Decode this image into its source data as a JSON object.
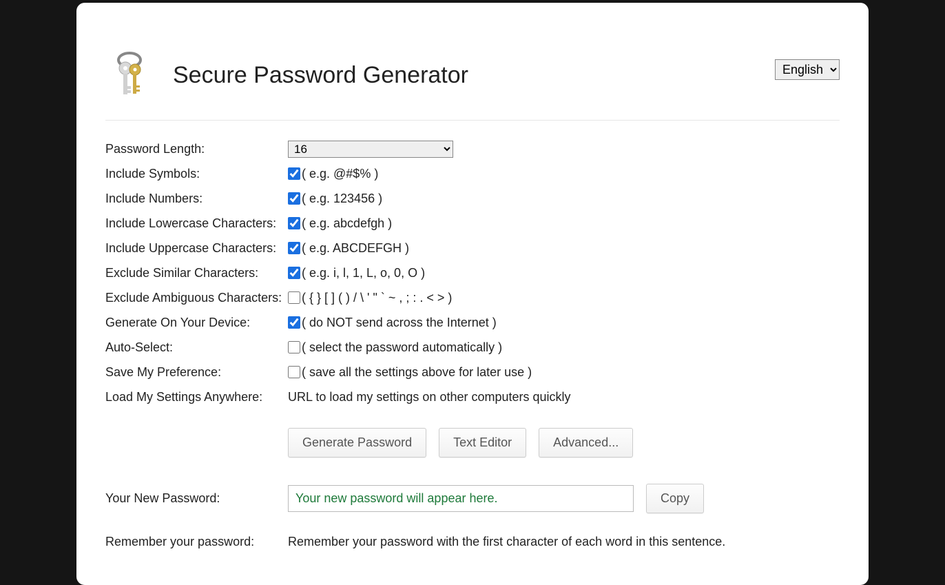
{
  "header": {
    "title": "Secure Password Generator",
    "language_selected": "English"
  },
  "labels": {
    "password_length": "Password Length:",
    "include_symbols": "Include Symbols:",
    "include_numbers": "Include Numbers:",
    "include_lowercase": "Include Lowercase Characters:",
    "include_uppercase": "Include Uppercase Characters:",
    "exclude_similar": "Exclude Similar Characters:",
    "exclude_ambiguous": "Exclude Ambiguous Characters:",
    "generate_on_device": "Generate On Your Device:",
    "auto_select": "Auto-Select:",
    "save_preference": "Save My Preference:",
    "load_settings": "Load My Settings Anywhere:",
    "your_new_password": "Your New Password:",
    "remember": "Remember your password:"
  },
  "hints": {
    "symbols": "( e.g. @#$% )",
    "numbers": "( e.g. 123456 )",
    "lowercase": "( e.g. abcdefgh )",
    "uppercase": "( e.g. ABCDEFGH )",
    "similar": "( e.g. i, l, 1, L, o, 0, O )",
    "ambiguous": "( { } [ ] ( ) / \\ ' \" ` ~ , ; : . < > )",
    "on_device": "( do NOT send across the Internet )",
    "auto_select": "( select the password automatically )",
    "save_pref": "( save all the settings above for later use )",
    "load_settings": "URL to load my settings on other computers quickly",
    "remember": "Remember your password with the first character of each word in this sentence."
  },
  "values": {
    "password_length": "16",
    "new_password_placeholder": "Your new password will appear here."
  },
  "buttons": {
    "generate": "Generate Password",
    "text_editor": "Text Editor",
    "advanced": "Advanced...",
    "copy": "Copy"
  }
}
